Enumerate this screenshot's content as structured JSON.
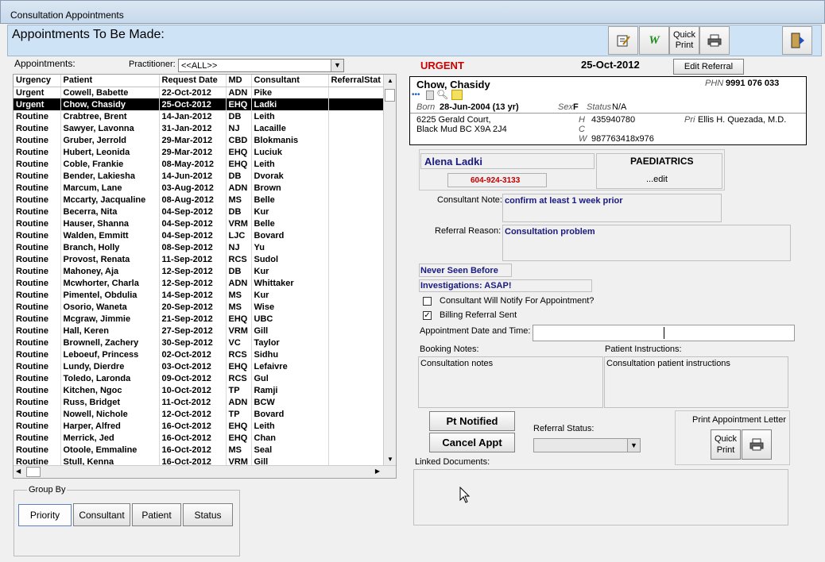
{
  "window": {
    "title": "Consultation Appointments"
  },
  "header": {
    "title": "Appointments To Be Made:",
    "quick_print": "Quick Print"
  },
  "filter": {
    "appointments_label": "Appointments:",
    "practitioner_label": "Practitioner:",
    "practitioner_value": "<<ALL>>"
  },
  "urgency_banner": "URGENT",
  "date_banner": "25-Oct-2012",
  "edit_referral": "Edit Referral",
  "columns": [
    "Urgency",
    "Patient",
    "Request Date",
    "MD",
    "Consultant",
    "ReferralStat"
  ],
  "rows": [
    [
      "Urgent",
      "Cowell, Babette",
      "22-Oct-2012",
      "ADN",
      "Pike"
    ],
    [
      "Urgent",
      "Chow, Chasidy",
      "25-Oct-2012",
      "EHQ",
      "Ladki"
    ],
    [
      "Routine",
      "Crabtree, Brent",
      "14-Jan-2012",
      "DB",
      "Leith"
    ],
    [
      "Routine",
      "Sawyer, Lavonna",
      "31-Jan-2012",
      "NJ",
      "Lacaille"
    ],
    [
      "Routine",
      "Gruber, Jerrold",
      "29-Mar-2012",
      "CBD",
      "Blokmanis"
    ],
    [
      "Routine",
      "Hubert, Leonida",
      "29-Mar-2012",
      "EHQ",
      "Luciuk"
    ],
    [
      "Routine",
      "Coble, Frankie",
      "08-May-2012",
      "EHQ",
      "Leith"
    ],
    [
      "Routine",
      "Bender, Lakiesha",
      "14-Jun-2012",
      "DB",
      "Dvorak"
    ],
    [
      "Routine",
      "Marcum, Lane",
      "03-Aug-2012",
      "ADN",
      "Brown"
    ],
    [
      "Routine",
      "Mccarty, Jacqualine",
      "08-Aug-2012",
      "MS",
      "Belle"
    ],
    [
      "Routine",
      "Becerra, Nita",
      "04-Sep-2012",
      "DB",
      "Kur"
    ],
    [
      "Routine",
      "Hauser, Shanna",
      "04-Sep-2012",
      "VRM",
      "Belle"
    ],
    [
      "Routine",
      "Walden, Emmitt",
      "04-Sep-2012",
      "LJC",
      "Bovard"
    ],
    [
      "Routine",
      "Branch, Holly",
      "08-Sep-2012",
      "NJ",
      "Yu"
    ],
    [
      "Routine",
      "Provost, Renata",
      "11-Sep-2012",
      "RCS",
      "Sudol"
    ],
    [
      "Routine",
      "Mahoney, Aja",
      "12-Sep-2012",
      "DB",
      "Kur"
    ],
    [
      "Routine",
      "Mcwhorter, Charla",
      "12-Sep-2012",
      "ADN",
      "Whittaker"
    ],
    [
      "Routine",
      "Pimentel, Obdulia",
      "14-Sep-2012",
      "MS",
      "Kur"
    ],
    [
      "Routine",
      "Osorio, Waneta",
      "20-Sep-2012",
      "MS",
      "Wise"
    ],
    [
      "Routine",
      "Mcgraw, Jimmie",
      "21-Sep-2012",
      "EHQ",
      "UBC"
    ],
    [
      "Routine",
      "Hall, Keren",
      "27-Sep-2012",
      "VRM",
      "Gill"
    ],
    [
      "Routine",
      "Brownell, Zachery",
      "30-Sep-2012",
      "VC",
      "Taylor"
    ],
    [
      "Routine",
      "Leboeuf, Princess",
      "02-Oct-2012",
      "RCS",
      "Sidhu"
    ],
    [
      "Routine",
      "Lundy, Dierdre",
      "03-Oct-2012",
      "EHQ",
      "Lefaivre"
    ],
    [
      "Routine",
      "Toledo, Laronda",
      "09-Oct-2012",
      "RCS",
      "Gul"
    ],
    [
      "Routine",
      "Kitchen, Ngoc",
      "10-Oct-2012",
      "TP",
      "Ramji"
    ],
    [
      "Routine",
      "Russ, Bridget",
      "11-Oct-2012",
      "ADN",
      "BCW"
    ],
    [
      "Routine",
      "Nowell, Nichole",
      "12-Oct-2012",
      "TP",
      "Bovard"
    ],
    [
      "Routine",
      "Harper, Alfred",
      "16-Oct-2012",
      "EHQ",
      "Leith"
    ],
    [
      "Routine",
      "Merrick, Jed",
      "16-Oct-2012",
      "EHQ",
      "Chan"
    ],
    [
      "Routine",
      "Otoole, Emmaline",
      "16-Oct-2012",
      "MS",
      "Seal"
    ],
    [
      "Routine",
      "Stull, Kenna",
      "16-Oct-2012",
      "VRM",
      "Gill"
    ]
  ],
  "selected_row": 1,
  "group_by": {
    "label": "Group By",
    "buttons": [
      "Priority",
      "Consultant",
      "Patient",
      "Status"
    ]
  },
  "patient": {
    "name": "Chow, Chasidy",
    "phn_label": "PHN",
    "phn": "9991 076 033",
    "born_label": "Born",
    "born": "28-Jun-2004 (13 yr)",
    "sex_label": "Sex",
    "sex": "F",
    "status_label": "Status",
    "status": "N/A",
    "address1": "6225 Gerald Court,",
    "address2": "Black Mud BC  X9A 2J4",
    "h_label": "H",
    "h": "435940780",
    "c_label": "C",
    "w_label": "W",
    "w": "987763418x976",
    "pri_label": "Pri",
    "pri": "Ellis H. Quezada, M.D."
  },
  "consultant": {
    "name": "Alena Ladki",
    "phone": "604-924-3133",
    "specialty": "PAEDIATRICS",
    "edit": "...edit"
  },
  "consultant_note_label": "Consultant Note:",
  "consultant_note": "confirm at least 1 week prior",
  "referral_reason_label": "Referral Reason:",
  "referral_reason": "Consultation problem",
  "never_seen": "Never Seen Before",
  "investigations": "Investigations: ASAP!",
  "notify_label": "Consultant Will Notify For Appointment?",
  "billing_label": "Billing Referral Sent",
  "appt_datetime_label": "Appointment Date and Time:",
  "booking_notes_label": "Booking Notes:",
  "booking_notes": "Consultation notes",
  "patient_instructions_label": "Patient Instructions:",
  "patient_instructions": "Consultation patient instructions",
  "pt_notified": "Pt Notified",
  "cancel_appt": "Cancel Appt",
  "referral_status_label": "Referral Status:",
  "print_letter_label": "Print Appointment Letter",
  "quick_print_small": "Quick Print",
  "linked_documents_label": "Linked Documents:"
}
